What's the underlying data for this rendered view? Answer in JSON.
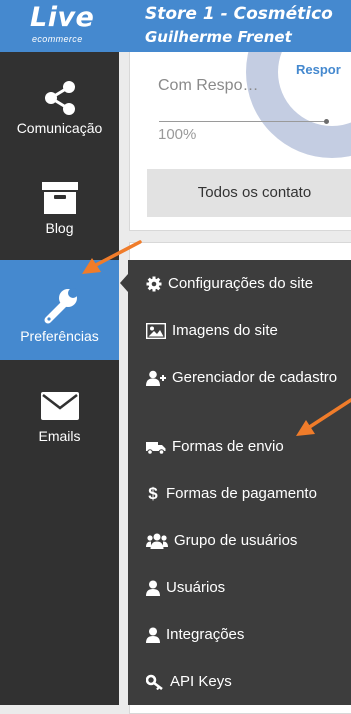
{
  "header": {
    "logo_word": "Live",
    "logo_tagline": "ecommerce",
    "store_name": "Store 1 - Cosmético",
    "user_name": "Guilherme Frenet"
  },
  "sidebar": {
    "items": [
      {
        "label": "Comunicação",
        "icon": "share-icon"
      },
      {
        "label": "Blog",
        "icon": "archive-box-icon"
      },
      {
        "label": "Preferências",
        "icon": "wrench-icon",
        "active": true
      },
      {
        "label": "Emails",
        "icon": "envelope-icon"
      }
    ]
  },
  "main": {
    "donut_label": "Respor",
    "stat_label": "Com Respo…",
    "stat_value": "100%",
    "contacts_button": "Todos os contato"
  },
  "menu": {
    "items": [
      {
        "label": "Configurações do site",
        "icon": "gear-icon"
      },
      {
        "label": "Imagens do site",
        "icon": "image-icon"
      },
      {
        "label": "Gerenciador de cadastro",
        "icon": "user-plus-icon"
      },
      {
        "label": "Formas de envio",
        "icon": "truck-icon"
      },
      {
        "label": "Formas de pagamento",
        "icon": "dollar-icon"
      },
      {
        "label": "Grupo de usuários",
        "icon": "users-icon"
      },
      {
        "label": "Usuários",
        "icon": "user-icon"
      },
      {
        "label": "Integrações",
        "icon": "user-icon"
      },
      {
        "label": "API Keys",
        "icon": "key-icon"
      }
    ]
  },
  "colors": {
    "header_blue": "#4589cf",
    "sidebar_dark": "#313131",
    "menu_dark": "#3d3d3d",
    "annotation_arrow": "#f07c2a"
  }
}
